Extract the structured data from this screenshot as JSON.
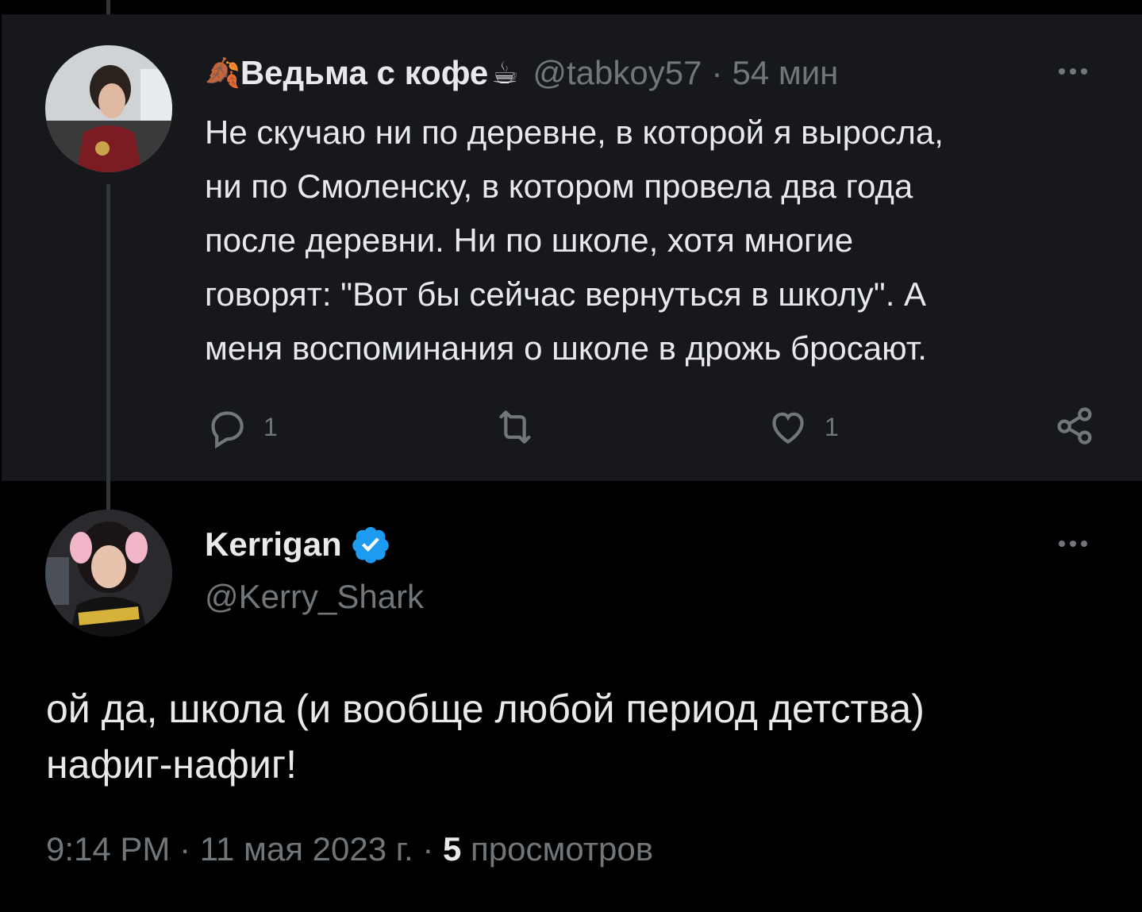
{
  "reply_tweet": {
    "display_name_emoji_prefix": "🍂",
    "display_name": "Ведьма с кофе",
    "display_name_emoji_suffix": "☕",
    "handle": "@tabkoy57",
    "separator": "·",
    "time": "54 мин",
    "text": "Не скучаю ни по деревне, в которой я выросла,\nни по Смоленску, в котором провела два года\nпосле деревни. Ни по школе, хотя многие\nговорят: \"Вот бы сейчас вернуться в школу\". А\nменя воспоминания о школе в дрожь бросают.",
    "reply_count": "1",
    "like_count": "1"
  },
  "main_tweet": {
    "display_name": "Kerrigan",
    "handle": "@Kerry_Shark",
    "text": "ой да, школа (и вообще любой период детства)\nнафиг-нафиг!",
    "time": "9:14 PM",
    "separator": "·",
    "date": "11 мая 2023 г.",
    "views_count": "5",
    "views_label": "просмотров"
  },
  "colors": {
    "background": "#000000",
    "panel": "#16181c",
    "text": "#e7e9ea",
    "muted": "#71767b",
    "verified": "#1d9bf0"
  },
  "icons": [
    "more-icon",
    "reply-icon",
    "retweet-icon",
    "like-icon",
    "share-icon",
    "verified-badge-icon"
  ]
}
